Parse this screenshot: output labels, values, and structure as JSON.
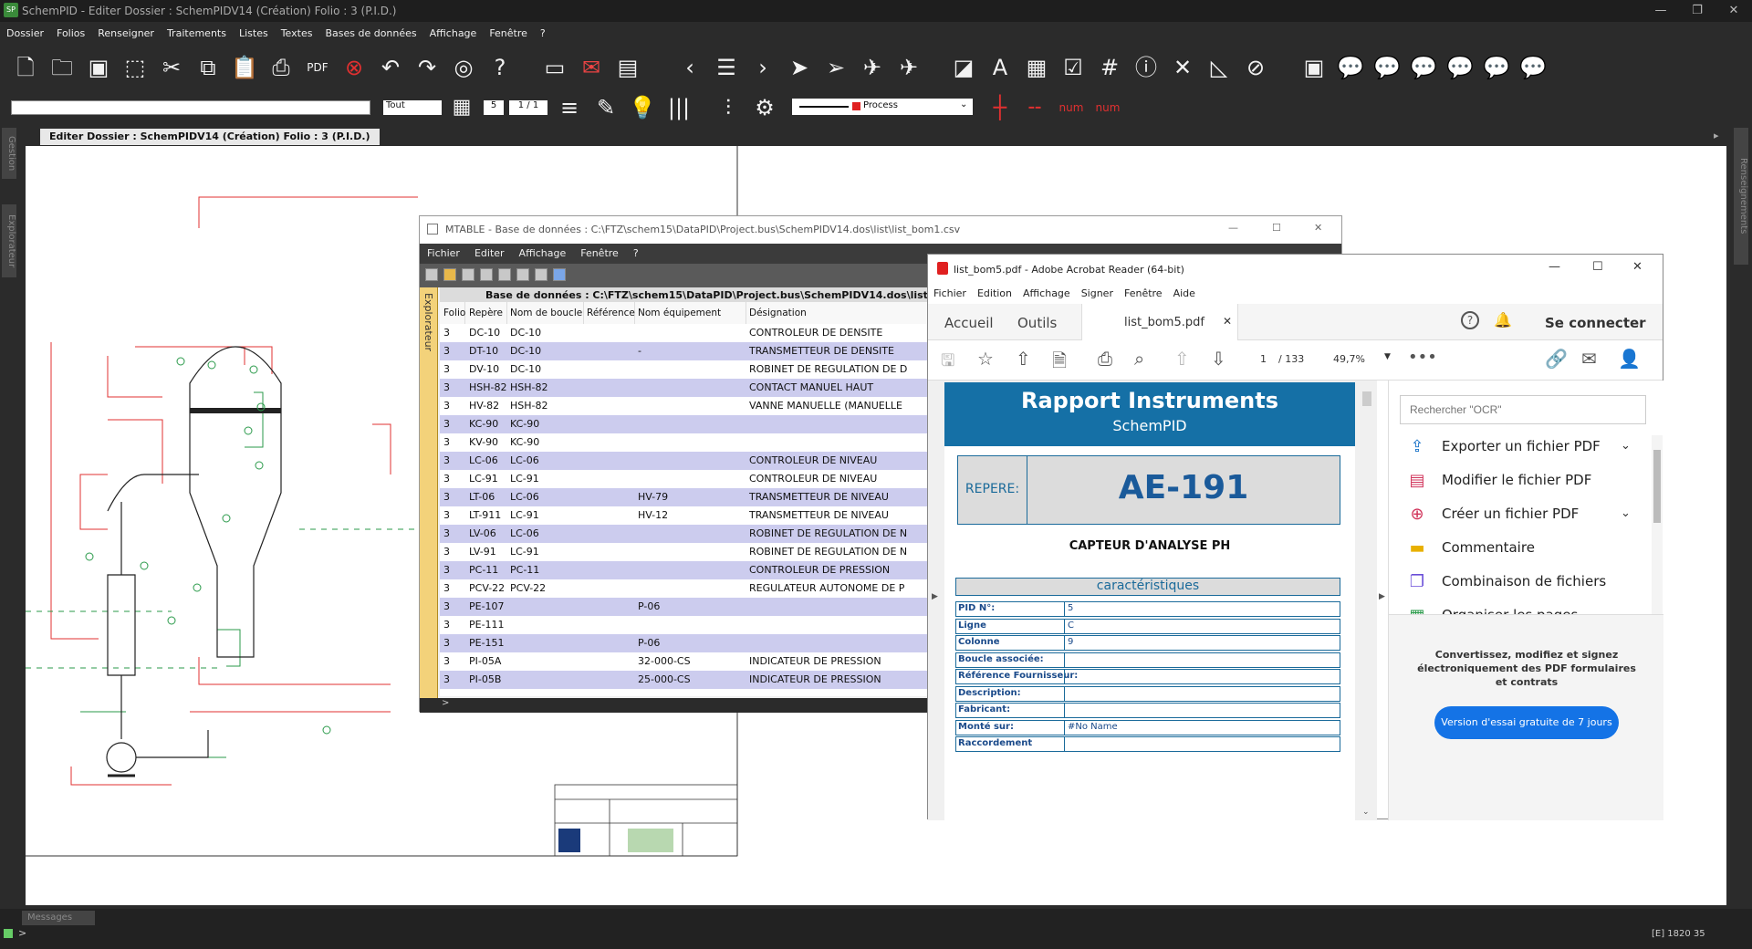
{
  "app": {
    "title": "SchemPID - Editer  Dossier : SchemPIDV14  (Création)  Folio : 3  (P.I.D.)",
    "icon_label": "SP",
    "menu": [
      "Dossier",
      "Folios",
      "Renseigner",
      "Traitements",
      "Listes",
      "Textes",
      "Bases de données",
      "Affichage",
      "Fenêtre",
      "?"
    ],
    "toolbar2": {
      "filter_value": "Tout",
      "layer_value": "5",
      "page_value": "1 / 1",
      "line_style_label": "Process"
    },
    "doc_tab": "Editer  Dossier : SchemPIDV14  (Création)  Folio : 3  (P.I.D.)",
    "left_tabs": [
      "Gestion",
      "Explorateur"
    ],
    "right_tabs": [
      "Renseignements"
    ],
    "status": {
      "messages_label": "Messages",
      "prompt": ">",
      "coords": "[E]  1820  35"
    }
  },
  "mtable": {
    "title": "MTABLE - Base de données : C:\\FTZ\\schem15\\DataPID\\Project.bus\\SchemPIDV14.dos\\list\\list_bom1.csv",
    "menu": [
      "Fichier",
      "Editer",
      "Affichage",
      "Fenêtre",
      "?"
    ],
    "side_tab": "Explorateur",
    "db_header": "Base de données : C:\\FTZ\\schem15\\DataPID\\Project.bus\\SchemPIDV14.dos\\list\\list_bom1.csv",
    "columns": [
      "Folio",
      "Repère",
      "Nom de boucle",
      "Référence",
      "Nom équipement",
      "Désignation"
    ],
    "rows": [
      [
        "3",
        "DC-10",
        "DC-10",
        "",
        "",
        "CONTROLEUR DE DENSITE"
      ],
      [
        "3",
        "DT-10",
        "DC-10",
        "",
        "-",
        "TRANSMETTEUR DE DENSITE"
      ],
      [
        "3",
        "DV-10",
        "DC-10",
        "",
        "",
        "ROBINET DE REGULATION DE D"
      ],
      [
        "3",
        "HSH-82",
        "HSH-82",
        "",
        "",
        "CONTACT MANUEL HAUT"
      ],
      [
        "3",
        "HV-82",
        "HSH-82",
        "",
        "",
        "VANNE MANUELLE (MANUELLE"
      ],
      [
        "3",
        "KC-90",
        "KC-90",
        "",
        "",
        ""
      ],
      [
        "3",
        "KV-90",
        "KC-90",
        "",
        "",
        ""
      ],
      [
        "3",
        "LC-06",
        "LC-06",
        "",
        "",
        "CONTROLEUR DE NIVEAU"
      ],
      [
        "3",
        "LC-91",
        "LC-91",
        "",
        "",
        "CONTROLEUR DE NIVEAU"
      ],
      [
        "3",
        "LT-06",
        "LC-06",
        "",
        "HV-79",
        "TRANSMETTEUR DE NIVEAU"
      ],
      [
        "3",
        "LT-911",
        "LC-91",
        "",
        "HV-12",
        "TRANSMETTEUR DE NIVEAU"
      ],
      [
        "3",
        "LV-06",
        "LC-06",
        "",
        "",
        "ROBINET DE REGULATION DE N"
      ],
      [
        "3",
        "LV-91",
        "LC-91",
        "",
        "",
        "ROBINET DE REGULATION DE N"
      ],
      [
        "3",
        "PC-11",
        "PC-11",
        "",
        "",
        "CONTROLEUR DE PRESSION"
      ],
      [
        "3",
        "PCV-22",
        "PCV-22",
        "",
        "",
        "REGULATEUR AUTONOME DE P"
      ],
      [
        "3",
        "PE-107",
        "",
        "",
        "P-06",
        ""
      ],
      [
        "3",
        "PE-111",
        "",
        "",
        "",
        ""
      ],
      [
        "3",
        "PE-151",
        "",
        "",
        "P-06",
        ""
      ],
      [
        "3",
        "PI-05A",
        "",
        "",
        "32-000-CS",
        "INDICATEUR DE PRESSION"
      ],
      [
        "3",
        "PI-05B",
        "",
        "",
        "25-000-CS",
        "INDICATEUR DE PRESSION"
      ]
    ],
    "bottom_prompt": ">"
  },
  "acrobat": {
    "title": "list_bom5.pdf - Adobe Acrobat Reader (64-bit)",
    "menu": [
      "Fichier",
      "Edition",
      "Affichage",
      "Signer",
      "Fenêtre",
      "Aide"
    ],
    "tabs": {
      "home": "Accueil",
      "tools": "Outils",
      "file": "list_bom5.pdf",
      "signin": "Se connecter"
    },
    "page_current": "1",
    "page_total": "/  133",
    "zoom": "49,7%",
    "search_placeholder": "Rechercher \"OCR\"",
    "panel_items": [
      {
        "label": "Exporter un fichier PDF",
        "icon": "export-pdf-icon",
        "color": "#1a73c8",
        "glyph": "⇪",
        "chevron": true
      },
      {
        "label": "Modifier le fichier PDF",
        "icon": "edit-pdf-icon",
        "color": "#d1345b",
        "glyph": "▤",
        "chevron": false
      },
      {
        "label": "Créer un fichier PDF",
        "icon": "create-pdf-icon",
        "color": "#d1345b",
        "glyph": "⊕",
        "chevron": true
      },
      {
        "label": "Commentaire",
        "icon": "comment-icon",
        "color": "#e8b000",
        "glyph": "▬",
        "chevron": false
      },
      {
        "label": "Combinaison de fichiers",
        "icon": "combine-files-icon",
        "color": "#6a4ed8",
        "glyph": "❐",
        "chevron": false
      },
      {
        "label": "Organiser les pages",
        "icon": "organize-pages-icon",
        "color": "#2a9a4a",
        "glyph": "▦",
        "chevron": true
      }
    ],
    "promo": "Convertissez, modifiez et signez électroniquement des PDF formulaires et contrats",
    "trial_button": "Version d'essai gratuite de 7 jours",
    "report": {
      "title": "Rapport Instruments",
      "subtitle": "SchemPID",
      "repere_label": "REPERE:",
      "repere_value": "AE-191",
      "description": "CAPTEUR D'ANALYSE PH",
      "section": "caractéristiques",
      "fields": [
        {
          "k": "PID N°:",
          "v": "5"
        },
        {
          "k": "Ligne",
          "v": "C"
        },
        {
          "k": "Colonne",
          "v": "9"
        },
        {
          "k": "Boucle associée:",
          "v": ""
        },
        {
          "k": "Référence Fournisseur:",
          "v": ""
        },
        {
          "k": "Description:",
          "v": ""
        },
        {
          "k": "Fabricant:",
          "v": ""
        },
        {
          "k": "Monté sur:",
          "v": "#No Name"
        },
        {
          "k": "Raccordement",
          "v": ""
        }
      ]
    }
  },
  "colors": {
    "report_blue": "#1570a6",
    "accent_red": "#e02020",
    "trial_button": "#1473e6",
    "mtable_alt_row": "#ccccee"
  }
}
